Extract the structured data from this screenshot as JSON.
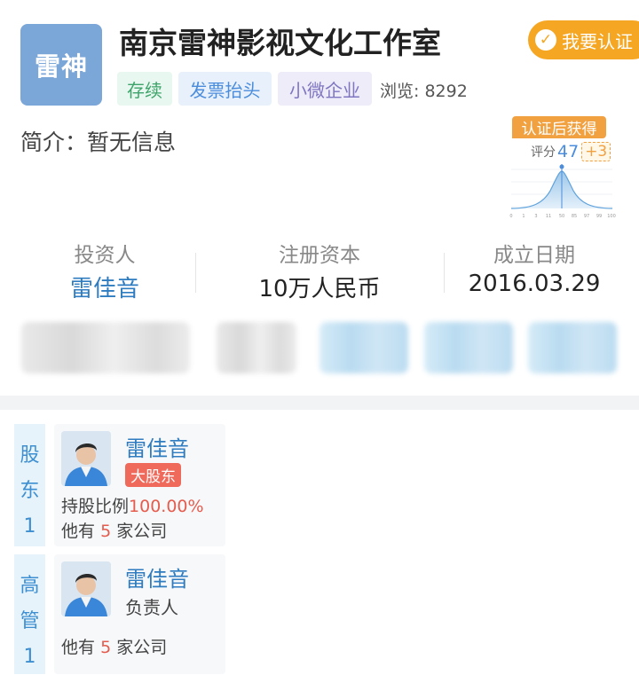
{
  "company": {
    "logo_text": "雷神",
    "name": "南京雷神影视文化工作室",
    "cert_button": "我要认证",
    "tags": [
      "存续",
      "发票抬头",
      "小微企业"
    ],
    "views": "浏览: 8292",
    "intro": "简介：暂无信息"
  },
  "score": {
    "badge": "认证后获得",
    "label": "评分",
    "value": "47",
    "plus": "+3",
    "axis_ticks": [
      "0",
      "1",
      "3",
      "11",
      "50",
      "85",
      "97",
      "99",
      "100"
    ]
  },
  "stats": [
    {
      "label": "投资人",
      "value": "雷佳音"
    },
    {
      "label": "注册资本",
      "value": "10万人民币"
    },
    {
      "label": "成立日期",
      "value": "2016.03.29"
    }
  ],
  "shareholder": {
    "tab": [
      "股",
      "东",
      "1"
    ],
    "name": "雷佳音",
    "badge": "大股东",
    "stake_label": "持股比例",
    "stake_value": "100.00%",
    "companies_prefix": "他有",
    "companies_count": "5",
    "companies_suffix": "家公司"
  },
  "executive": {
    "tab": [
      "高",
      "管",
      "1"
    ],
    "name": "雷佳音",
    "role": "负责人",
    "companies_prefix": "他有",
    "companies_count": "5",
    "companies_suffix": "家公司"
  },
  "colors": {
    "logo_bg": "#7aa6d8",
    "cert_orange": "#f5a623",
    "link_blue": "#2f7cc0",
    "badge_red": "#f06a5c"
  }
}
